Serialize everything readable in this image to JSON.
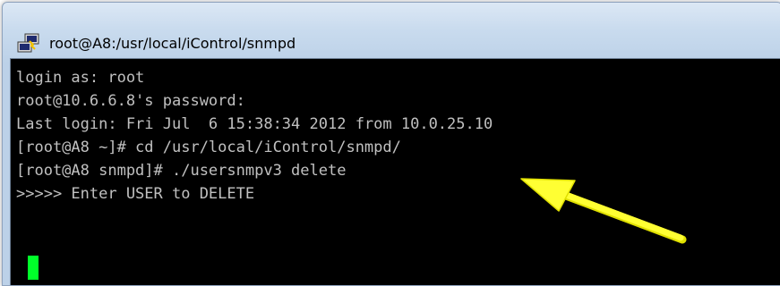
{
  "window": {
    "title": "root@A8:/usr/local/iControl/snmpd",
    "icon": "putty-icon"
  },
  "terminal": {
    "lines": [
      "login as: root",
      "root@10.6.6.8's password:",
      "Last login: Fri Jul  6 15:38:34 2012 from 10.0.25.10",
      "[root@A8 ~]# cd /usr/local/iControl/snmpd/",
      "[root@A8 snmpd]# ./usersnmpv3 delete",
      ">>>>> Enter USER to DELETE"
    ],
    "foreground_color": "#c0c0c0",
    "background_color": "#000000",
    "cursor_color": "#00ff2a"
  },
  "annotation": {
    "icon": "arrow-icon",
    "color": "#ffff33"
  }
}
